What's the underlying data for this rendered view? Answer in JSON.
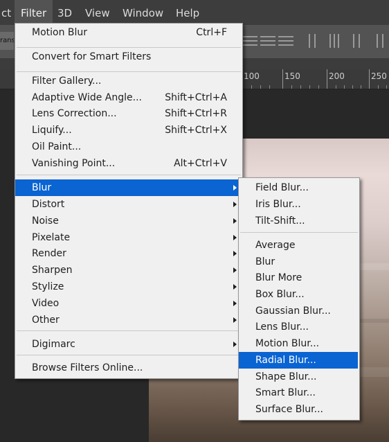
{
  "menubar": {
    "items": [
      {
        "label": "ct"
      },
      {
        "label": "Filter"
      },
      {
        "label": "3D"
      },
      {
        "label": "View"
      },
      {
        "label": "Window"
      },
      {
        "label": "Help"
      }
    ]
  },
  "options_bar": {
    "left_label": "rans"
  },
  "ruler": {
    "labels": [
      "100",
      "150",
      "200",
      "250"
    ]
  },
  "filter_menu": {
    "last_filter": {
      "label": "Motion Blur",
      "shortcut": "Ctrl+F"
    },
    "convert": {
      "label": "Convert for Smart Filters"
    },
    "filter_gallery": {
      "label": "Filter Gallery..."
    },
    "adaptive_wide_angle": {
      "label": "Adaptive Wide Angle...",
      "shortcut": "Shift+Ctrl+A"
    },
    "lens_correction": {
      "label": "Lens Correction...",
      "shortcut": "Shift+Ctrl+R"
    },
    "liquify": {
      "label": "Liquify...",
      "shortcut": "Shift+Ctrl+X"
    },
    "oil_paint": {
      "label": "Oil Paint..."
    },
    "vanishing_point": {
      "label": "Vanishing Point...",
      "shortcut": "Alt+Ctrl+V"
    },
    "submenus": {
      "blur": "Blur",
      "distort": "Distort",
      "noise": "Noise",
      "pixelate": "Pixelate",
      "render": "Render",
      "sharpen": "Sharpen",
      "stylize": "Stylize",
      "video": "Video",
      "other": "Other"
    },
    "digimarc": {
      "label": "Digimarc"
    },
    "browse_online": {
      "label": "Browse Filters Online..."
    }
  },
  "blur_submenu": {
    "field_blur": "Field Blur...",
    "iris_blur": "Iris Blur...",
    "tilt_shift": "Tilt-Shift...",
    "average": "Average",
    "blur": "Blur",
    "blur_more": "Blur More",
    "box_blur": "Box Blur...",
    "gaussian_blur": "Gaussian Blur...",
    "lens_blur": "Lens Blur...",
    "motion_blur": "Motion Blur...",
    "radial_blur": "Radial Blur...",
    "shape_blur": "Shape Blur...",
    "smart_blur": "Smart Blur...",
    "surface_blur": "Surface Blur..."
  },
  "colors": {
    "highlight": "#0a64d2",
    "menu_bg": "#f0f0f0",
    "app_bg": "#3c3c3c"
  }
}
